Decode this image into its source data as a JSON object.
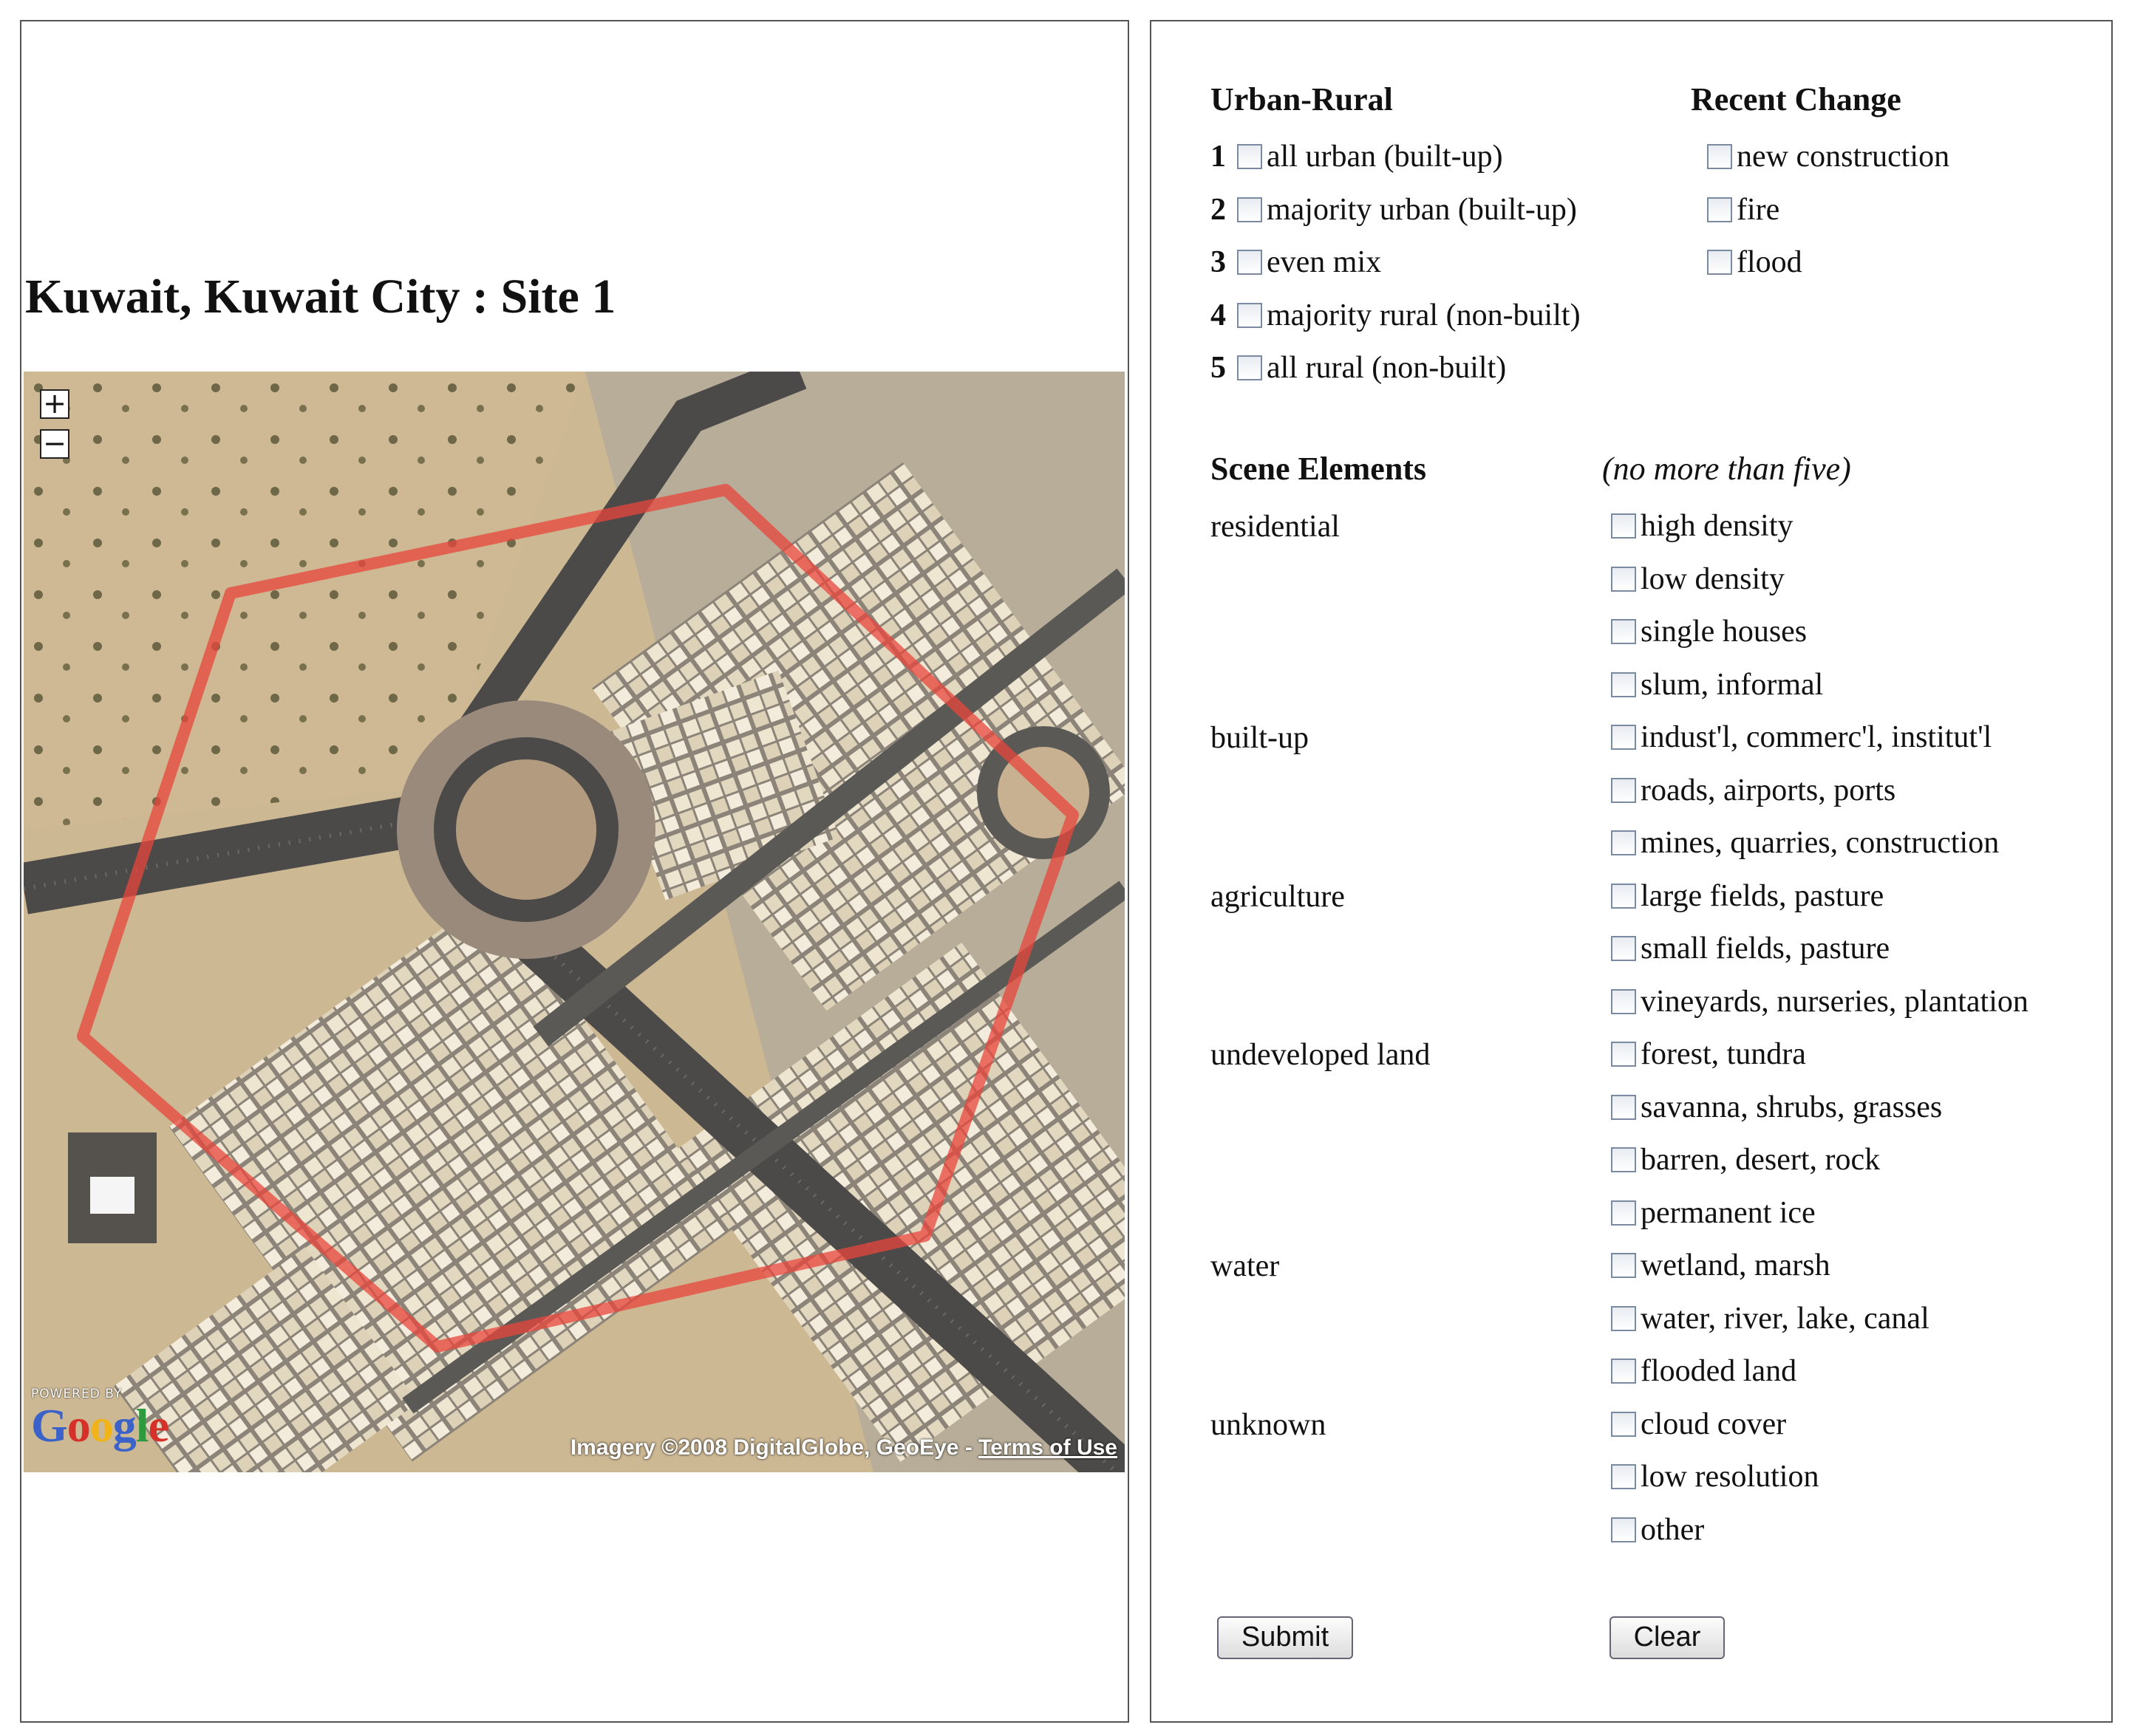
{
  "site_title": "Kuwait, Kuwait City : Site 1",
  "map": {
    "zoom_in": "+",
    "zoom_out": "−",
    "powered_by": "POWERED BY",
    "logo": [
      "G",
      "o",
      "o",
      "g",
      "l",
      "e"
    ],
    "logo_colors": [
      "#3a62c9",
      "#d6302a",
      "#f0b418",
      "#3a62c9",
      "#2e9a3e",
      "#d6302a"
    ],
    "attribution": "Imagery ©2008 DigitalGlobe, GeoEye - ",
    "terms": "Terms of Use",
    "overlay_color": "#e8463c"
  },
  "urban_rural": {
    "heading": "Urban-Rural",
    "options": [
      {
        "num": "1",
        "label": "all urban (built-up)"
      },
      {
        "num": "2",
        "label": "majority urban (built-up)"
      },
      {
        "num": "3",
        "label": "even mix"
      },
      {
        "num": "4",
        "label": "majority rural (non-built)"
      },
      {
        "num": "5",
        "label": "all rural (non-built)"
      }
    ]
  },
  "recent_change": {
    "heading": "Recent Change",
    "options": [
      "new construction",
      "fire",
      "flood"
    ]
  },
  "scene_elements": {
    "heading": "Scene Elements",
    "note": "(no more than five)",
    "categories": [
      {
        "label": "residential",
        "options": [
          "high density",
          "low density",
          "single houses",
          "slum, informal"
        ]
      },
      {
        "label": "built-up",
        "options": [
          "indust'l, commerc'l, institut'l",
          "roads, airports, ports",
          "mines, quarries, construction"
        ]
      },
      {
        "label": "agriculture",
        "options": [
          "large fields, pasture",
          "small fields, pasture",
          "vineyards, nurseries, plantation"
        ]
      },
      {
        "label": "undeveloped land",
        "options": [
          "forest, tundra",
          "savanna, shrubs, grasses",
          "barren, desert, rock",
          "permanent ice"
        ]
      },
      {
        "label": "water",
        "options": [
          "wetland, marsh",
          "water, river, lake, canal",
          "flooded land"
        ]
      },
      {
        "label": "unknown",
        "options": [
          "cloud cover",
          "low resolution",
          "other"
        ]
      }
    ]
  },
  "buttons": {
    "submit": "Submit",
    "clear": "Clear"
  }
}
